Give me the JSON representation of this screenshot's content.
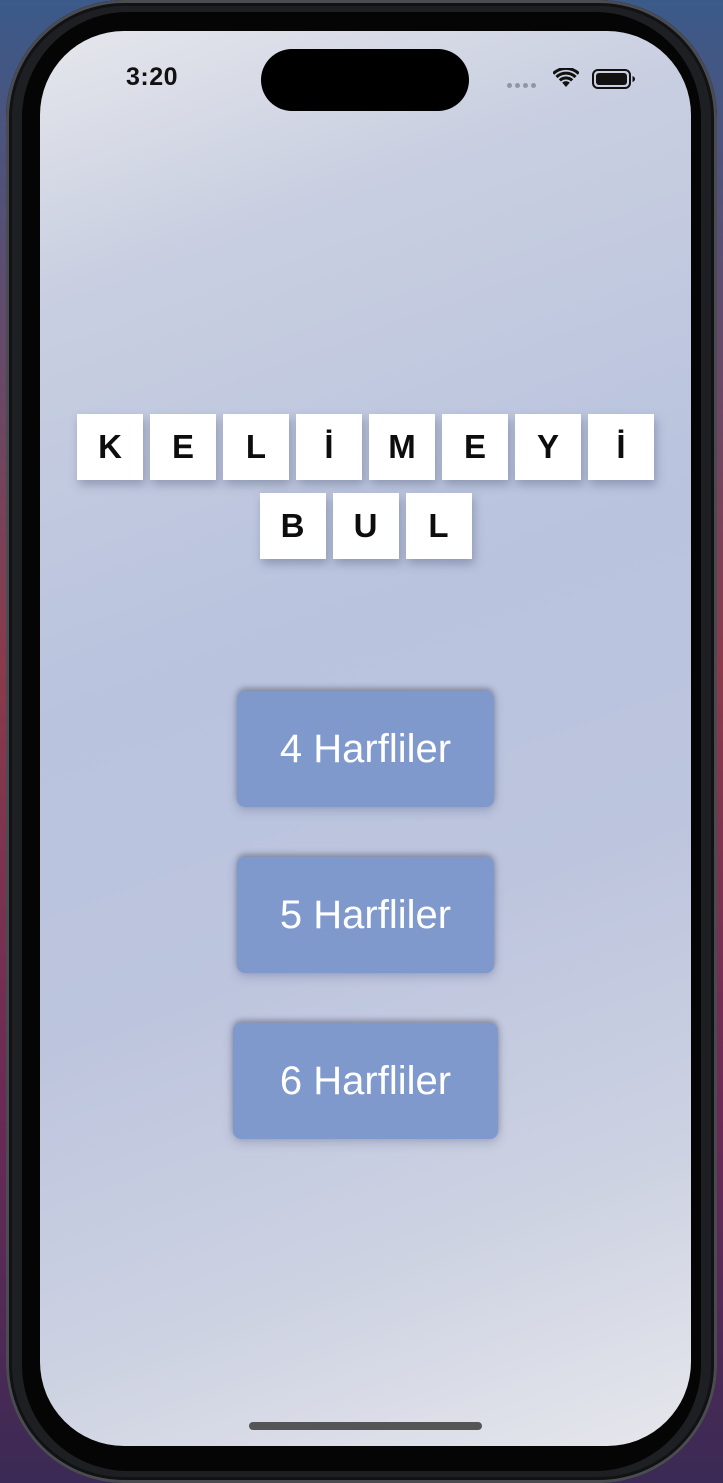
{
  "status_bar": {
    "time": "3:20",
    "icons": [
      "cellular-dots-icon",
      "wifi-icon",
      "battery-icon"
    ]
  },
  "title": {
    "row1": [
      "K",
      "E",
      "L",
      "İ",
      "M",
      "E",
      "Y",
      "İ"
    ],
    "row2": [
      "B",
      "U",
      "L"
    ]
  },
  "menu": {
    "button_4": "4 Harfliler",
    "button_5": "5 Harfliler",
    "button_6": "6 Harfliler"
  },
  "colors": {
    "button": "#8099cc",
    "button_text": "#ffffff",
    "tile": "#ffffff",
    "tile_text": "#0d0d0d"
  }
}
